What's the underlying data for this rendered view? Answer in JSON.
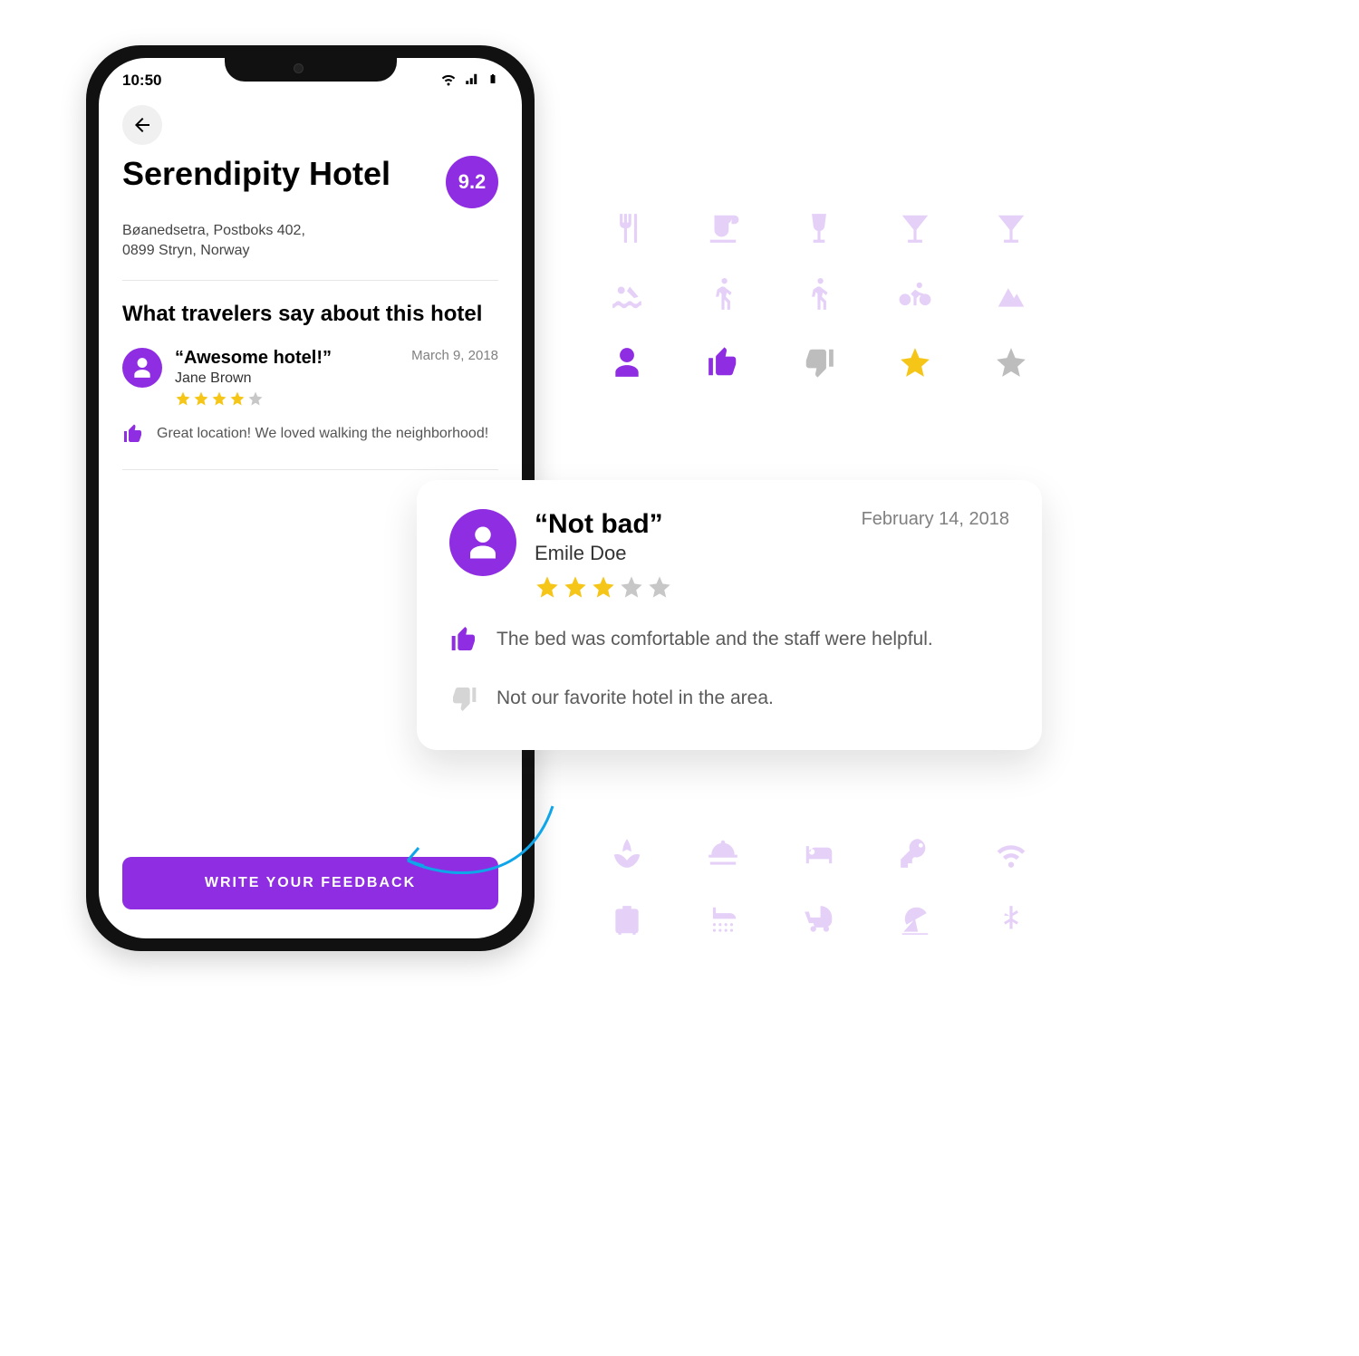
{
  "status_bar": {
    "time": "10:50"
  },
  "hotel": {
    "name": "Serendipity Hotel",
    "score": "9.2",
    "address_line1": "Bøanedsetra, Postboks 402,",
    "address_line2": "0899 Stryn, Norway"
  },
  "section_title": "What travelers say about this hotel",
  "review1": {
    "title": "“Awesome hotel!”",
    "author": "Jane Brown",
    "date": "March 9, 2018",
    "stars": 4,
    "positive": "Great location! We loved walking the neighborhood!"
  },
  "review_card": {
    "title": "“Not bad”",
    "author": "Emile Doe",
    "date": "February 14, 2018",
    "stars": 3,
    "positive": "The bed was comfortable and the staff were helpful.",
    "negative": "Not our favorite hotel in the area."
  },
  "cta_label": "WRITE YOUR FEEDBACK",
  "icon_palette": {
    "row1": [
      "restaurant-icon",
      "coffee-icon",
      "wine-icon",
      "cocktail-icon",
      "martini-icon"
    ],
    "row2": [
      "swim-icon",
      "walk-icon",
      "hike-icon",
      "bike-icon",
      "mountain-icon"
    ],
    "row3": [
      {
        "name": "person-icon",
        "color": "purple"
      },
      {
        "name": "thumbs-up-icon",
        "color": "purple"
      },
      {
        "name": "thumbs-down-icon",
        "color": "gray"
      },
      {
        "name": "star-filled-icon",
        "color": "gold"
      },
      {
        "name": "star-empty-icon",
        "color": "gray"
      }
    ],
    "bottom1": [
      "spa-icon",
      "concierge-icon",
      "bed-icon",
      "key-icon",
      "wifi-icon"
    ],
    "bottom2": [
      "luggage-icon",
      "shower-icon",
      "stroller-icon",
      "beach-icon",
      "snowflake-icon"
    ]
  }
}
